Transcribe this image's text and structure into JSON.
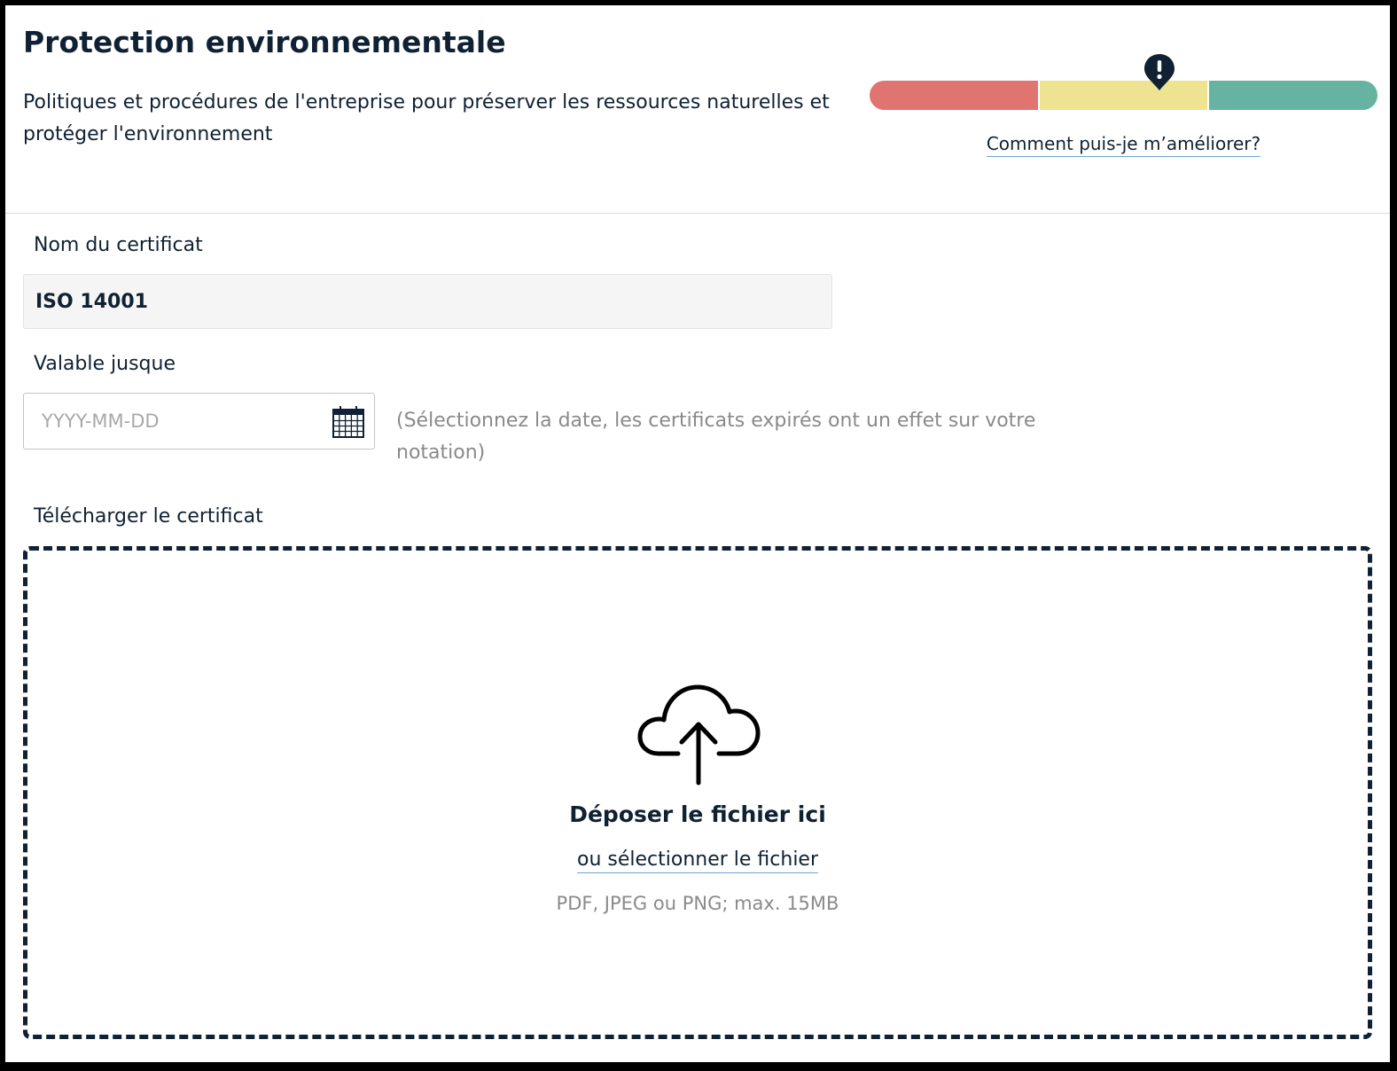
{
  "section": {
    "title": "Protection environnementale",
    "description": "Politiques et procédures de l'entreprise pour préserver les ressources naturelles et protéger l'environnement"
  },
  "rating": {
    "segment_colors": [
      "#e07470",
      "#ede391",
      "#66b3a1"
    ],
    "marker_color": "#0f2133",
    "marker_icon": "exclamation-pin-icon",
    "marker_position": 0.57,
    "improve_link": "Comment puis-je m’améliorer?"
  },
  "certificate_name": {
    "label": "Nom du certificat",
    "value": "ISO 14001"
  },
  "valid_until": {
    "label": "Valable jusque",
    "placeholder": "YYYY-MM-DD",
    "value": "",
    "calendar_icon": "calendar-icon",
    "hint": "(Sélectionnez la date, les certificats expirés ont un effet sur votre notation)"
  },
  "upload": {
    "label": "Télécharger le certificat",
    "icon": "cloud-upload-icon",
    "drop_text": "Déposer le fichier ici",
    "select_link": "ou sélectionner le fichier",
    "file_types": "PDF, JPEG ou PNG; max. 15MB"
  },
  "colors": {
    "text": "#0f2133",
    "muted": "#8a8a8a",
    "link_underline": "#6fa6cf",
    "input_bg": "#f5f5f5"
  }
}
